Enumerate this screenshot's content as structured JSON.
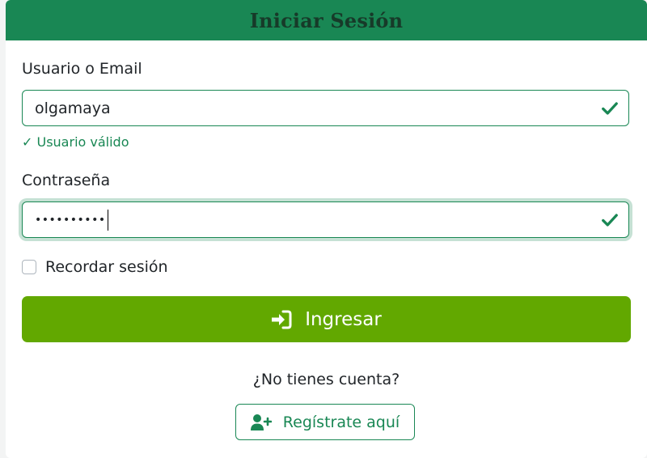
{
  "header": {
    "title": "Iniciar Sesión"
  },
  "form": {
    "username": {
      "label": "Usuario o Email",
      "value": "olgamaya",
      "feedback": "✓ Usuario válido"
    },
    "password": {
      "label": "Contraseña",
      "masked_value": "••••••••••"
    },
    "remember": {
      "label": "Recordar sesión",
      "checked": false
    },
    "submit": {
      "label": "Ingresar",
      "icon": "sign-in-icon"
    }
  },
  "footer": {
    "prompt": "¿No tienes cuenta?",
    "register": {
      "label": "Regístrate aquí",
      "icon": "user-plus-icon"
    }
  },
  "colors": {
    "header_bg": "#198754",
    "valid": "#198754",
    "submit_bg": "#62a800"
  }
}
